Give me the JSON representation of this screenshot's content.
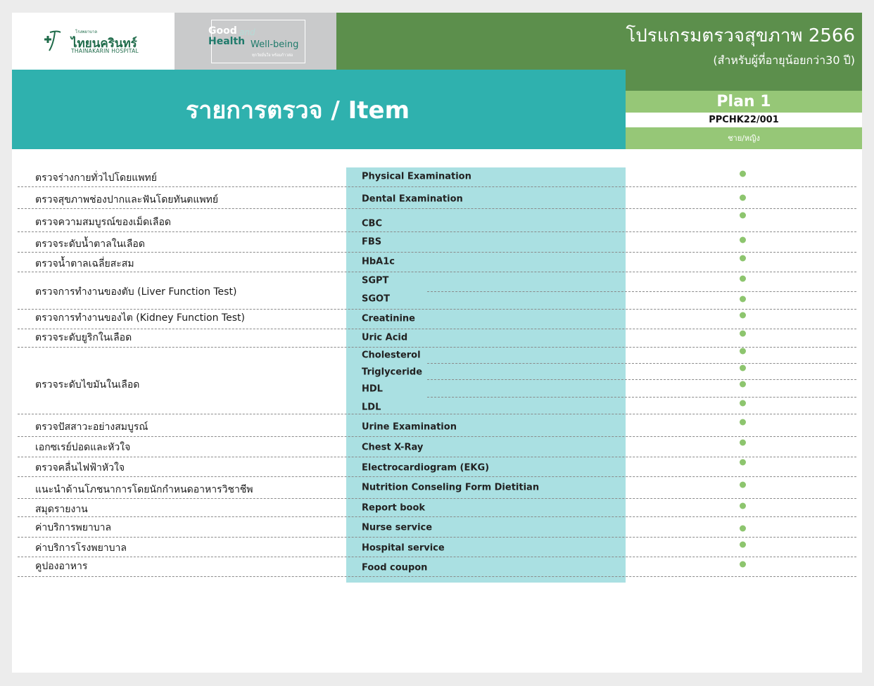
{
  "header": {
    "logo": {
      "thai_small": "โรงพยาบาล",
      "thai_name": "ไทยนครินทร์",
      "english_name": "THAINAKARIN HOSPITAL"
    },
    "campaign": {
      "good": "Good",
      "and": "and",
      "health": "Health",
      "wellbeing": "Well-being",
      "tagline": "ทุกวัยมั่นใจ พร้อมก้าวต่อ"
    },
    "program_title": "โปรแกรมตรวจสุขภาพ 2566",
    "program_subtitle": "(สำหรับผู้ที่อายุน้อยกว่า30 ปี)"
  },
  "banner": {
    "item_title": "รายการตรวจ / Item"
  },
  "plan": {
    "label": "Plan 1",
    "code": "PPCHK22/001",
    "gender": "ชาย/หญิง"
  },
  "colors": {
    "teal": "#2fb1ae",
    "dark_green": "#5c8f4c",
    "light_green": "#96c777",
    "light_teal": "#aae0e2",
    "dot": "#8dc56e"
  },
  "thai_items": [
    "ตรวจร่างกายทั่วไปโดยแพทย์",
    "ตรวจสุขภาพช่องปากและฟันโดยทันตแพทย์",
    "ตรวจความสมบูรณ์ของเม็ดเลือด",
    "ตรวจระดับน้ำตาลในเลือด",
    "ตรวจน้ำตาลเฉลี่ยสะสม",
    "ตรวจการทำงานของตับ (Liver Function Test)",
    "ตรวจการทำงานของไต (Kidney Function Test)",
    "ตรวจระดับยูริกในเลือด",
    "ตรวจระดับไขมันในเลือด",
    "ตรวจปัสสาวะอย่างสมบูรณ์",
    "เอกซเรย์ปอดและหัวใจ",
    "ตรวจคลื่นไฟฟ้าหัวใจ",
    "แนะนำด้านโภชนาการโดยนักกำหนดอาหารวิชาชีพ",
    "สมุดรายงาน",
    "ค่าบริการพยาบาล",
    "ค่าบริการโรงพยาบาล",
    "คูปองอาหาร"
  ],
  "tests": [
    {
      "name": "Physical Examination",
      "included": true
    },
    {
      "name": "Dental Examination",
      "included": true
    },
    {
      "name": "CBC",
      "included": true
    },
    {
      "name": "FBS",
      "included": true
    },
    {
      "name": "HbA1c",
      "included": true
    },
    {
      "name": "SGPT",
      "included": true
    },
    {
      "name": "SGOT",
      "included": true
    },
    {
      "name": "Creatinine",
      "included": true
    },
    {
      "name": "Uric Acid",
      "included": true
    },
    {
      "name": "Cholesterol",
      "included": true
    },
    {
      "name": "Triglyceride",
      "included": true
    },
    {
      "name": "HDL",
      "included": true
    },
    {
      "name": "LDL",
      "included": true
    },
    {
      "name": "Urine Examination",
      "included": true
    },
    {
      "name": "Chest X-Ray",
      "included": true
    },
    {
      "name": "Electrocardiogram (EKG)",
      "included": true
    },
    {
      "name": "Nutrition Conseling Form Dietitian",
      "included": true
    },
    {
      "name": "Report book",
      "included": true
    },
    {
      "name": "Nurse service",
      "included": true
    },
    {
      "name": "Hospital service",
      "included": true
    },
    {
      "name": "Food coupon",
      "included": true
    }
  ]
}
